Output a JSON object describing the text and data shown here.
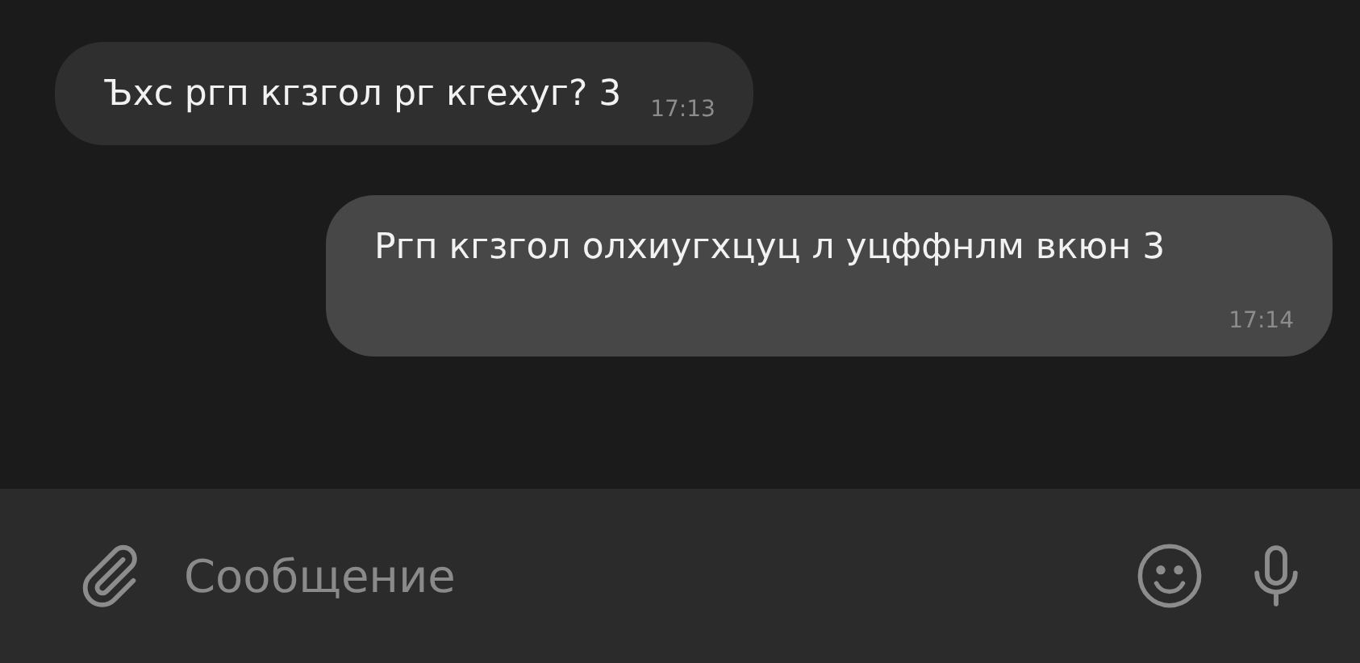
{
  "messages": [
    {
      "kind": "incoming",
      "text": "Ъхс ргп кгзгол рг кгехуг? 3",
      "time": "17:13"
    },
    {
      "kind": "outgoing",
      "text": "Ргп кгзгол олхиугхцуц л уцффнлм вкюн 3",
      "time": "17:14"
    }
  ],
  "composer": {
    "placeholder": "Сообщение"
  }
}
